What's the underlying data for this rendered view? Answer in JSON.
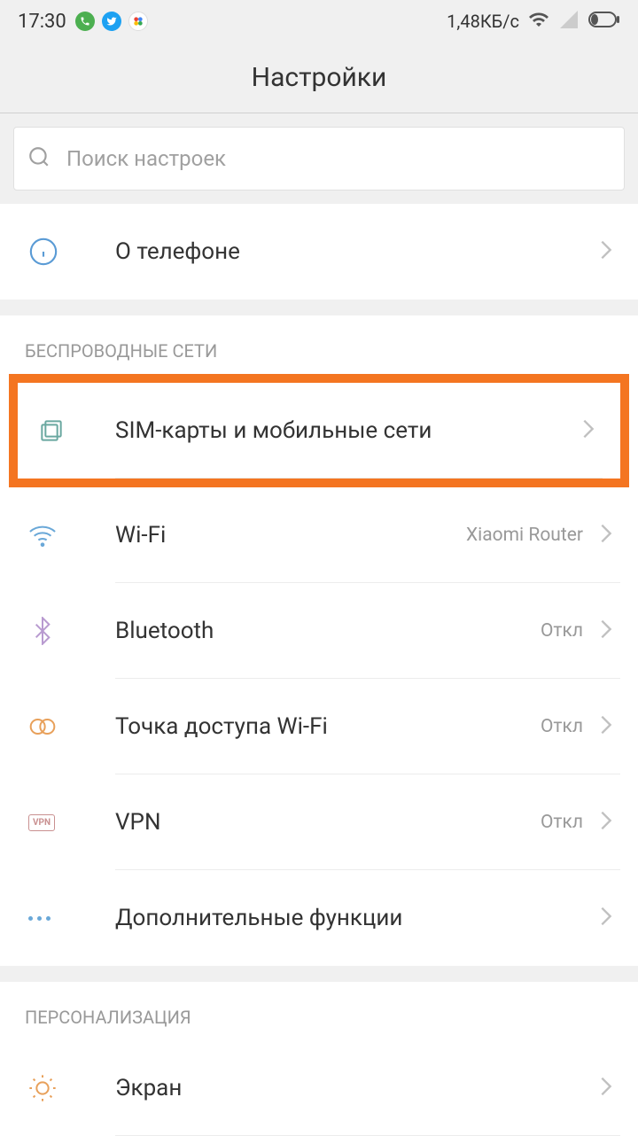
{
  "statusBar": {
    "time": "17:30",
    "dataSpeed": "1,48КБ/с"
  },
  "header": {
    "title": "Настройки"
  },
  "search": {
    "placeholder": "Поиск настроек"
  },
  "aboutPhone": {
    "label": "О телефоне"
  },
  "sections": {
    "wireless": {
      "header": "БЕСПРОВОДНЫЕ СЕТИ",
      "items": {
        "sim": {
          "label": "SIM-карты и мобильные сети"
        },
        "wifi": {
          "label": "Wi-Fi",
          "value": "Xiaomi Router"
        },
        "bluetooth": {
          "label": "Bluetooth",
          "value": "Откл"
        },
        "hotspot": {
          "label": "Точка доступа Wi-Fi",
          "value": "Откл"
        },
        "vpn": {
          "label": "VPN",
          "value": "Откл"
        },
        "more": {
          "label": "Дополнительные функции"
        }
      }
    },
    "personalization": {
      "header": "ПЕРСОНАЛИЗАЦИЯ",
      "items": {
        "display": {
          "label": "Экран"
        }
      }
    }
  },
  "vpnIconText": "VPN"
}
